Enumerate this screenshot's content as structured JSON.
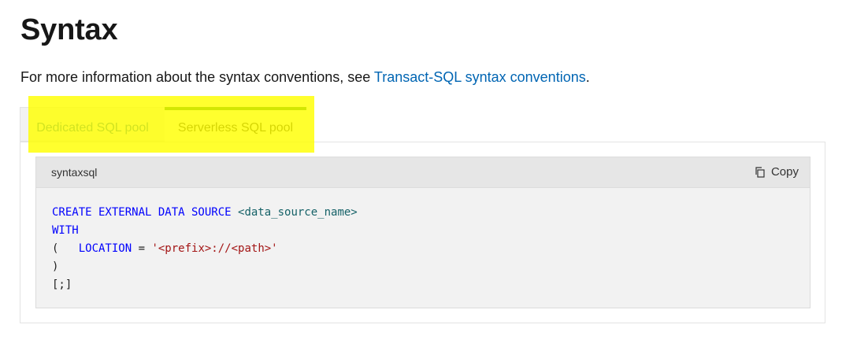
{
  "heading": "Syntax",
  "intro": {
    "text": "For more information about the syntax conventions, see ",
    "link": "Transact-SQL syntax conventions",
    "after": "."
  },
  "tabs": [
    {
      "label": "Dedicated SQL pool",
      "selected": false
    },
    {
      "label": "Serverless SQL pool",
      "selected": true
    }
  ],
  "code": {
    "language": "syntaxsql",
    "copy_label": "Copy",
    "lines": [
      [
        {
          "t": "kw",
          "v": "CREATE EXTERNAL DATA SOURCE"
        },
        {
          "t": "punc",
          "v": " "
        },
        {
          "t": "id",
          "v": "<data_source_name>"
        }
      ],
      [
        {
          "t": "kw",
          "v": "WITH"
        }
      ],
      [
        {
          "t": "punc",
          "v": "(   "
        },
        {
          "t": "kw",
          "v": "LOCATION"
        },
        {
          "t": "punc",
          "v": " = "
        },
        {
          "t": "str",
          "v": "'<prefix>://<path>'"
        }
      ],
      [
        {
          "t": "punc",
          "v": ")"
        }
      ],
      [
        {
          "t": "punc",
          "v": "[;]"
        }
      ]
    ]
  },
  "colors": {
    "link": "#0065b3",
    "selected_tab_bar": "#107c10",
    "highlight": "#ffff00",
    "keyword": "#0101fd",
    "identifier": "#166268",
    "string": "#a31515"
  },
  "icons": {
    "copy": "copy-icon"
  }
}
